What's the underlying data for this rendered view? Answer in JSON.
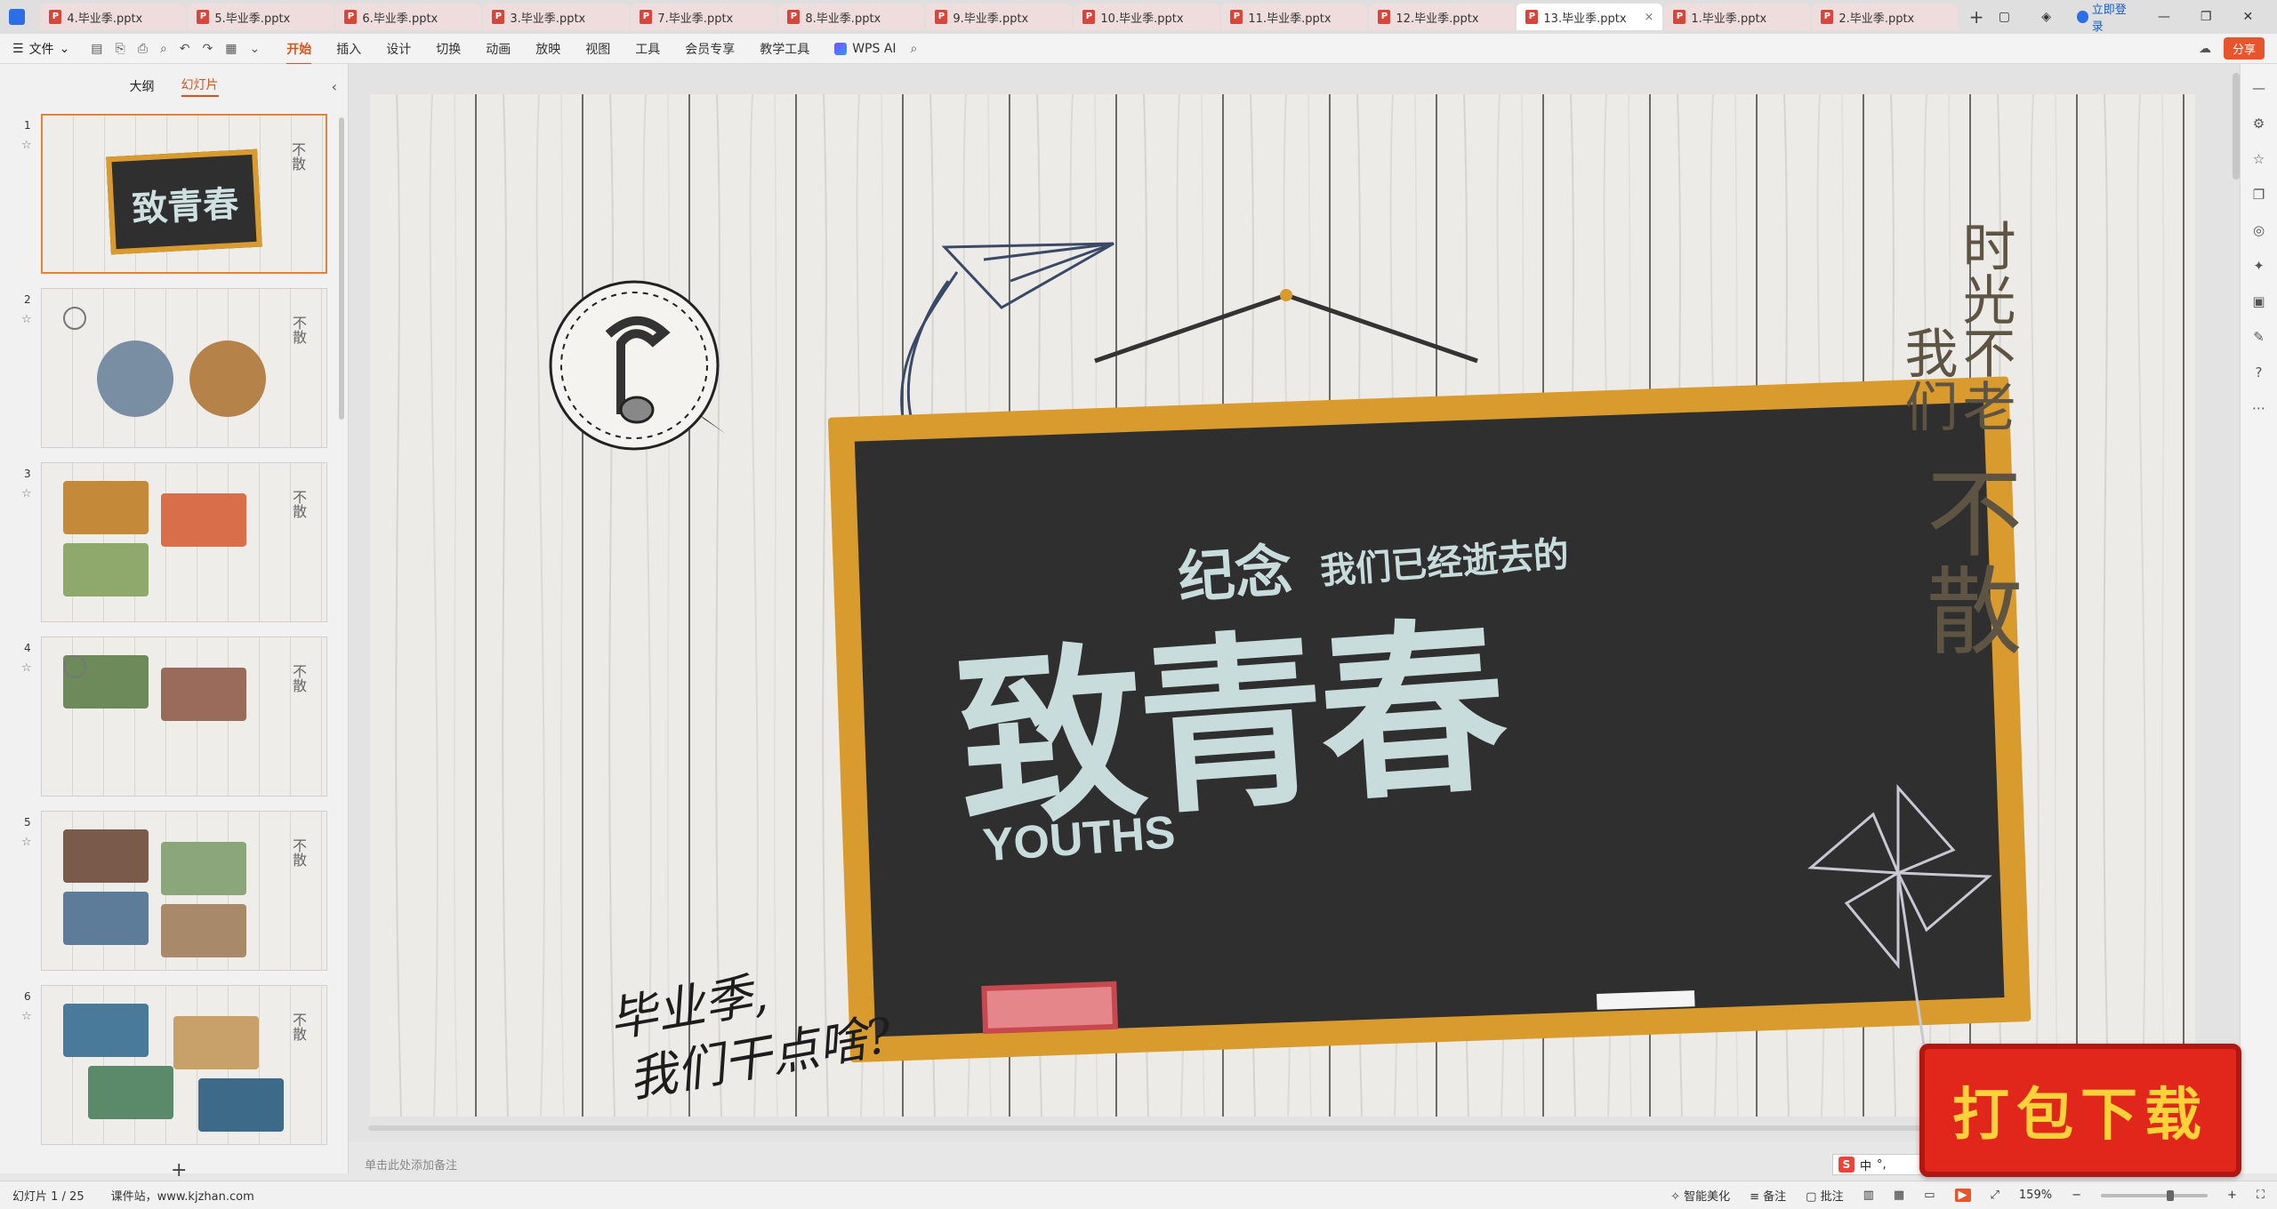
{
  "tabs": [
    {
      "label": "4.毕业季.pptx",
      "active": false
    },
    {
      "label": "5.毕业季.pptx",
      "active": false
    },
    {
      "label": "6.毕业季.pptx",
      "active": false
    },
    {
      "label": "3.毕业季.pptx",
      "active": false
    },
    {
      "label": "7.毕业季.pptx",
      "active": false
    },
    {
      "label": "8.毕业季.pptx",
      "active": false
    },
    {
      "label": "9.毕业季.pptx",
      "active": false
    },
    {
      "label": "10.毕业季.pptx",
      "active": false
    },
    {
      "label": "11.毕业季.pptx",
      "active": false
    },
    {
      "label": "12.毕业季.pptx",
      "active": false
    },
    {
      "label": "13.毕业季.pptx",
      "active": true
    },
    {
      "label": "1.毕业季.pptx",
      "active": false
    },
    {
      "label": "2.毕业季.pptx",
      "active": false
    }
  ],
  "titlebar": {
    "login": "立即登录"
  },
  "menubar": {
    "file": "文件",
    "items": [
      "开始",
      "插入",
      "设计",
      "切换",
      "动画",
      "放映",
      "视图",
      "工具",
      "会员专享",
      "教学工具"
    ],
    "active_item": "开始",
    "wps_ai": "WPS AI",
    "share": "分享"
  },
  "left_panel": {
    "tab_outline": "大纲",
    "tab_slides": "幻灯片",
    "thumbnails": [
      "1",
      "2",
      "3",
      "4",
      "5",
      "6"
    ],
    "mini_board_text": "致青春",
    "mini_side_text": "不散"
  },
  "slide": {
    "headline": "致青春",
    "headline_small": "纪念",
    "headline_sub": "我们已经逝去的",
    "youths": "YOUTHS",
    "handwriting_line1": "毕业季,",
    "handwriting_line2": "我们干点啥?",
    "side_col1": "时光不老",
    "side_col2": "我们",
    "side_big1": "不",
    "side_big2": "散",
    "colors": {
      "board": "#2f2f2f",
      "frame": "#d99a2e",
      "chalk_text": "#c9dcdc",
      "eraser": "#e4868a",
      "side_text": "#5e5443"
    }
  },
  "notes_placeholder": "单击此处添加备注",
  "status": {
    "slide_info": "幻灯片 1 / 25",
    "site": "课件站，www.kjzhan.com",
    "beautify": "智能美化",
    "notes": "备注",
    "comment": "批注",
    "zoom": "159%"
  },
  "ime": {
    "lang": "中"
  },
  "badge": {
    "text": "打包下载"
  }
}
